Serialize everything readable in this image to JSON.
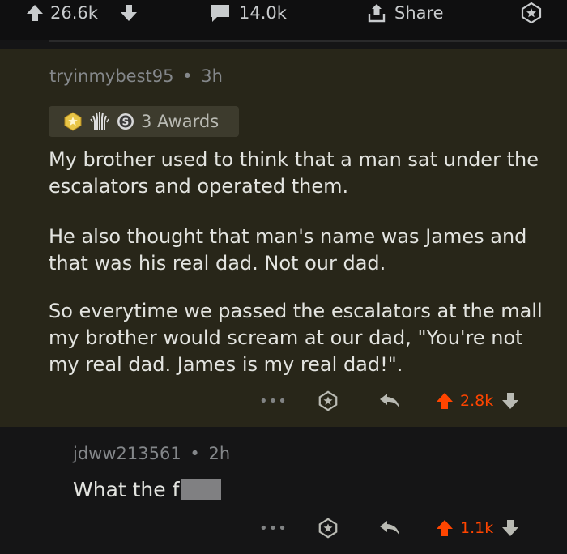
{
  "top_bar": {
    "upvote_count": "26.6k",
    "comment_count": "14.0k",
    "share_label": "Share"
  },
  "comment": {
    "author": "tryinmybest95",
    "separator": "•",
    "time": "3h",
    "awards_label": "3 Awards",
    "award_icons": [
      "star-award-icon",
      "wholesome-award-icon",
      "silver-award-icon"
    ],
    "paragraphs": [
      "My brother used to think that a man sat under the escalators and operated them.",
      "He also thought that man's name was James and that was his real dad. Not our dad.",
      "So everytime we passed the escalators at the mall my brother would scream at our dad, \"You're not my real dad. James is my real dad!\"."
    ],
    "more_label": "•••",
    "vote_count": "2.8k"
  },
  "reply": {
    "author": "jdww213561",
    "separator": "•",
    "time": "2h",
    "text": "What the f",
    "more_label": "•••",
    "vote_count": "1.1k"
  },
  "colors": {
    "background": "#151516",
    "highlight": "#282619",
    "upvoted": "#ff4500",
    "muted": "#84878a"
  }
}
